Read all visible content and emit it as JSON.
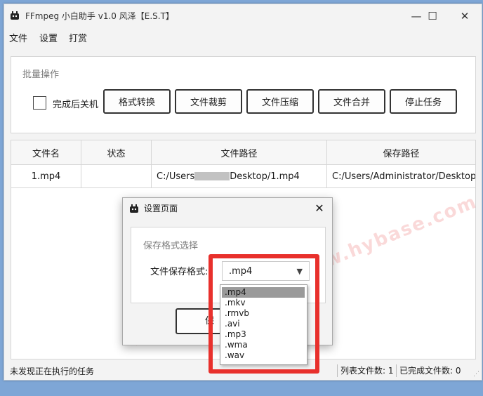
{
  "window": {
    "title": "FFmpeg 小白助手 v1.0 风泽【E.S.T】",
    "minimize_glyph": "—",
    "maximize_glyph": "☐",
    "close_glyph": "✕"
  },
  "menu": {
    "items": [
      "文件",
      "设置",
      "打赏"
    ]
  },
  "batch": {
    "title": "批量操作",
    "shutdown_label": "完成后关机",
    "buttons": [
      "格式转换",
      "文件裁剪",
      "文件压缩",
      "文件合并",
      "停止任务"
    ]
  },
  "table": {
    "headers": [
      "文件名",
      "状态",
      "文件路径",
      "保存路径"
    ],
    "rows": [
      {
        "name": "1.mp4",
        "status": "",
        "path_prefix": "C:/Users",
        "path_suffix": "Desktop/1.mp4",
        "save_path": "C:/Users/Administrator/Desktop..."
      }
    ]
  },
  "watermark": "记得收藏:黑域基地 www.hybase.com",
  "status": {
    "left": "未发现正在执行的任务",
    "list_count": "列表文件数: 1",
    "done_count": "已完成文件数: 0"
  },
  "dialog": {
    "title": "设置页面",
    "group_title": "保存格式选择",
    "format_label": "文件保存格式:",
    "selected_format": ".mp4",
    "save_button_partial": "保",
    "close_glyph": "✕",
    "options": [
      ".mp4",
      ".mkv",
      ".rmvb",
      ".avi",
      ".mp3",
      ".wma",
      ".wav"
    ]
  },
  "colors": {
    "highlight": "#e8302c",
    "selected_option": "#9a9a9a"
  },
  "icons": {
    "app": "robot-icon",
    "dropdown": "triangle-down-icon"
  }
}
